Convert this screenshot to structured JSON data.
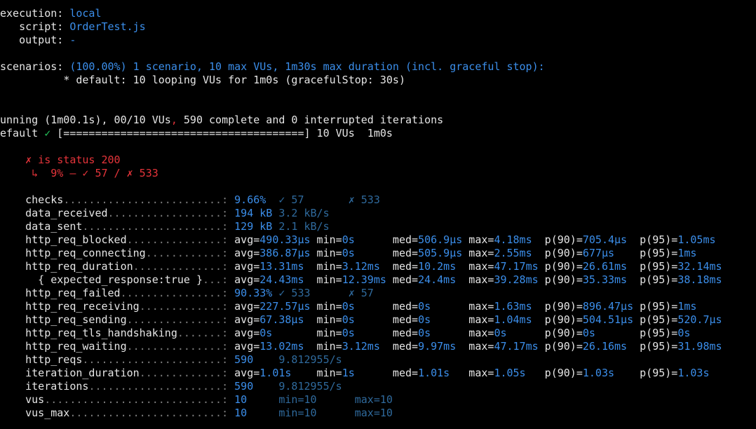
{
  "header": {
    "execution_key": "execution:",
    "execution_val": "local",
    "script_key": "script:",
    "script_val": "OrderTest.js",
    "output_key": "output:",
    "output_val": "-",
    "scenarios_key": "scenarios:",
    "scenarios_val": "(100.00%) 1 scenario, 10 max VUs, 1m30s max duration (incl. graceful stop):",
    "scenario_detail": "* default: 10 looping VUs for 1m0s (gracefulStop: 30s)"
  },
  "progress": {
    "running_a": "unning (1m00.1s), 00/10 VUs",
    "running_comma": ",",
    "running_b": " 590 complete and 0 interrupted iterations",
    "default_label": "efault ",
    "default_check": "✓",
    "default_bar": " [======================================] 10 VUs  1m0s"
  },
  "check": {
    "title": "✗ is status 200",
    "detail": "↳  9% — ✓ 57 / ✗ 533"
  },
  "colors": {
    "background": "#000000",
    "text": "#e6e6e6",
    "value_blue": "#3b8eea",
    "dim_blue": "#2f6a9d",
    "error_red": "#e5343a",
    "ok_green": "#23c25a",
    "dots": "#7d7d7d"
  },
  "metrics": [
    {
      "name": "checks",
      "dots": ".........................:",
      "cols": [
        {
          "t": " 9.66%",
          "s": "c"
        },
        {
          "t": "  ✓ 57",
          "s": "d"
        },
        {
          "t": "       ✗ 533",
          "s": "d"
        }
      ]
    },
    {
      "name": "data_received",
      "dots": "..................:",
      "cols": [
        {
          "t": " 194 kB",
          "s": "c"
        },
        {
          "t": " 3.2 kB/s",
          "s": "d"
        }
      ]
    },
    {
      "name": "data_sent",
      "dots": "......................:",
      "cols": [
        {
          "t": " 129 kB",
          "s": "c"
        },
        {
          "t": " 2.1 kB/s",
          "s": "d"
        }
      ]
    },
    {
      "name": "http_req_blocked",
      "dots": "...............:",
      "cols": [
        {
          "t": " avg=",
          "s": "w"
        },
        {
          "t": "490.33µs",
          "s": "c"
        },
        {
          "t": " min=",
          "s": "w"
        },
        {
          "t": "0s",
          "s": "c"
        },
        {
          "t": "      med=",
          "s": "w"
        },
        {
          "t": "506.9µs",
          "s": "c"
        },
        {
          "t": " max=",
          "s": "w"
        },
        {
          "t": "4.18ms",
          "s": "c"
        },
        {
          "t": "  p(90)=",
          "s": "w"
        },
        {
          "t": "705.4µs",
          "s": "c"
        },
        {
          "t": "  p(95)=",
          "s": "w"
        },
        {
          "t": "1.05ms",
          "s": "c"
        }
      ]
    },
    {
      "name": "http_req_connecting",
      "dots": "............:",
      "cols": [
        {
          "t": " avg=",
          "s": "w"
        },
        {
          "t": "386.87µs",
          "s": "c"
        },
        {
          "t": " min=",
          "s": "w"
        },
        {
          "t": "0s",
          "s": "c"
        },
        {
          "t": "      med=",
          "s": "w"
        },
        {
          "t": "505.9µs",
          "s": "c"
        },
        {
          "t": " max=",
          "s": "w"
        },
        {
          "t": "2.55ms",
          "s": "c"
        },
        {
          "t": "  p(90)=",
          "s": "w"
        },
        {
          "t": "677µs",
          "s": "c"
        },
        {
          "t": "    p(95)=",
          "s": "w"
        },
        {
          "t": "1ms",
          "s": "c"
        }
      ]
    },
    {
      "name": "http_req_duration",
      "dots": "..............:",
      "cols": [
        {
          "t": " avg=",
          "s": "w"
        },
        {
          "t": "13.31ms",
          "s": "c"
        },
        {
          "t": "  min=",
          "s": "w"
        },
        {
          "t": "3.12ms",
          "s": "c"
        },
        {
          "t": "  med=",
          "s": "w"
        },
        {
          "t": "10.2ms",
          "s": "c"
        },
        {
          "t": "  max=",
          "s": "w"
        },
        {
          "t": "47.17ms",
          "s": "c"
        },
        {
          "t": " p(90)=",
          "s": "w"
        },
        {
          "t": "26.61ms",
          "s": "c"
        },
        {
          "t": "  p(95)=",
          "s": "w"
        },
        {
          "t": "32.14ms",
          "s": "c"
        }
      ]
    },
    {
      "name": "  { expected_response:true }",
      "dots": "...:",
      "cols": [
        {
          "t": " avg=",
          "s": "w"
        },
        {
          "t": "24.43ms",
          "s": "c"
        },
        {
          "t": "  min=",
          "s": "w"
        },
        {
          "t": "12.39ms",
          "s": "c"
        },
        {
          "t": " med=",
          "s": "w"
        },
        {
          "t": "24.4ms",
          "s": "c"
        },
        {
          "t": "  max=",
          "s": "w"
        },
        {
          "t": "39.28ms",
          "s": "c"
        },
        {
          "t": " p(90)=",
          "s": "w"
        },
        {
          "t": "35.33ms",
          "s": "c"
        },
        {
          "t": "  p(95)=",
          "s": "w"
        },
        {
          "t": "38.18ms",
          "s": "c"
        }
      ]
    },
    {
      "name": "http_req_failed",
      "dots": "................:",
      "cols": [
        {
          "t": " 90.33%",
          "s": "c"
        },
        {
          "t": " ✓ 533",
          "s": "d"
        },
        {
          "t": "      ✗ 57",
          "s": "d"
        }
      ]
    },
    {
      "name": "http_req_receiving",
      "dots": ".............:",
      "cols": [
        {
          "t": " avg=",
          "s": "w"
        },
        {
          "t": "227.57µs",
          "s": "c"
        },
        {
          "t": " min=",
          "s": "w"
        },
        {
          "t": "0s",
          "s": "c"
        },
        {
          "t": "      med=",
          "s": "w"
        },
        {
          "t": "0s",
          "s": "c"
        },
        {
          "t": "      max=",
          "s": "w"
        },
        {
          "t": "1.63ms",
          "s": "c"
        },
        {
          "t": "  p(90)=",
          "s": "w"
        },
        {
          "t": "896.47µs",
          "s": "c"
        },
        {
          "t": " p(95)=",
          "s": "w"
        },
        {
          "t": "1ms",
          "s": "c"
        }
      ]
    },
    {
      "name": "http_req_sending",
      "dots": "...............:",
      "cols": [
        {
          "t": " avg=",
          "s": "w"
        },
        {
          "t": "67.38µs",
          "s": "c"
        },
        {
          "t": "  min=",
          "s": "w"
        },
        {
          "t": "0s",
          "s": "c"
        },
        {
          "t": "      med=",
          "s": "w"
        },
        {
          "t": "0s",
          "s": "c"
        },
        {
          "t": "      max=",
          "s": "w"
        },
        {
          "t": "1.04ms",
          "s": "c"
        },
        {
          "t": "  p(90)=",
          "s": "w"
        },
        {
          "t": "504.51µs",
          "s": "c"
        },
        {
          "t": " p(95)=",
          "s": "w"
        },
        {
          "t": "520.7µs",
          "s": "c"
        }
      ]
    },
    {
      "name": "http_req_tls_handshaking",
      "dots": ".......:",
      "cols": [
        {
          "t": " avg=",
          "s": "w"
        },
        {
          "t": "0s",
          "s": "c"
        },
        {
          "t": "       min=",
          "s": "w"
        },
        {
          "t": "0s",
          "s": "c"
        },
        {
          "t": "      med=",
          "s": "w"
        },
        {
          "t": "0s",
          "s": "c"
        },
        {
          "t": "      max=",
          "s": "w"
        },
        {
          "t": "0s",
          "s": "c"
        },
        {
          "t": "      p(90)=",
          "s": "w"
        },
        {
          "t": "0s",
          "s": "c"
        },
        {
          "t": "       p(95)=",
          "s": "w"
        },
        {
          "t": "0s",
          "s": "c"
        }
      ]
    },
    {
      "name": "http_req_waiting",
      "dots": "...............:",
      "cols": [
        {
          "t": " avg=",
          "s": "w"
        },
        {
          "t": "13.02ms",
          "s": "c"
        },
        {
          "t": "  min=",
          "s": "w"
        },
        {
          "t": "3.12ms",
          "s": "c"
        },
        {
          "t": "  med=",
          "s": "w"
        },
        {
          "t": "9.97ms",
          "s": "c"
        },
        {
          "t": "  max=",
          "s": "w"
        },
        {
          "t": "47.17ms",
          "s": "c"
        },
        {
          "t": " p(90)=",
          "s": "w"
        },
        {
          "t": "26.16ms",
          "s": "c"
        },
        {
          "t": "  p(95)=",
          "s": "w"
        },
        {
          "t": "31.98ms",
          "s": "c"
        }
      ]
    },
    {
      "name": "http_reqs",
      "dots": "......................:",
      "cols": [
        {
          "t": " 590",
          "s": "c"
        },
        {
          "t": "    9.812955/s",
          "s": "d"
        }
      ]
    },
    {
      "name": "iteration_duration",
      "dots": ".............:",
      "cols": [
        {
          "t": " avg=",
          "s": "w"
        },
        {
          "t": "1.01s",
          "s": "c"
        },
        {
          "t": "    min=",
          "s": "w"
        },
        {
          "t": "1s",
          "s": "c"
        },
        {
          "t": "      med=",
          "s": "w"
        },
        {
          "t": "1.01s",
          "s": "c"
        },
        {
          "t": "   max=",
          "s": "w"
        },
        {
          "t": "1.05s",
          "s": "c"
        },
        {
          "t": "   p(90)=",
          "s": "w"
        },
        {
          "t": "1.03s",
          "s": "c"
        },
        {
          "t": "    p(95)=",
          "s": "w"
        },
        {
          "t": "1.03s",
          "s": "c"
        }
      ]
    },
    {
      "name": "iterations",
      "dots": ".....................:",
      "cols": [
        {
          "t": " 590",
          "s": "c"
        },
        {
          "t": "    9.812955/s",
          "s": "d"
        }
      ]
    },
    {
      "name": "vus",
      "dots": "............................:",
      "cols": [
        {
          "t": " 10",
          "s": "c"
        },
        {
          "t": "     min=10",
          "s": "d"
        },
        {
          "t": "      max=10",
          "s": "d"
        }
      ]
    },
    {
      "name": "vus_max",
      "dots": "........................:",
      "cols": [
        {
          "t": " 10",
          "s": "c"
        },
        {
          "t": "     min=10",
          "s": "d"
        },
        {
          "t": "      max=10",
          "s": "d"
        }
      ]
    }
  ]
}
